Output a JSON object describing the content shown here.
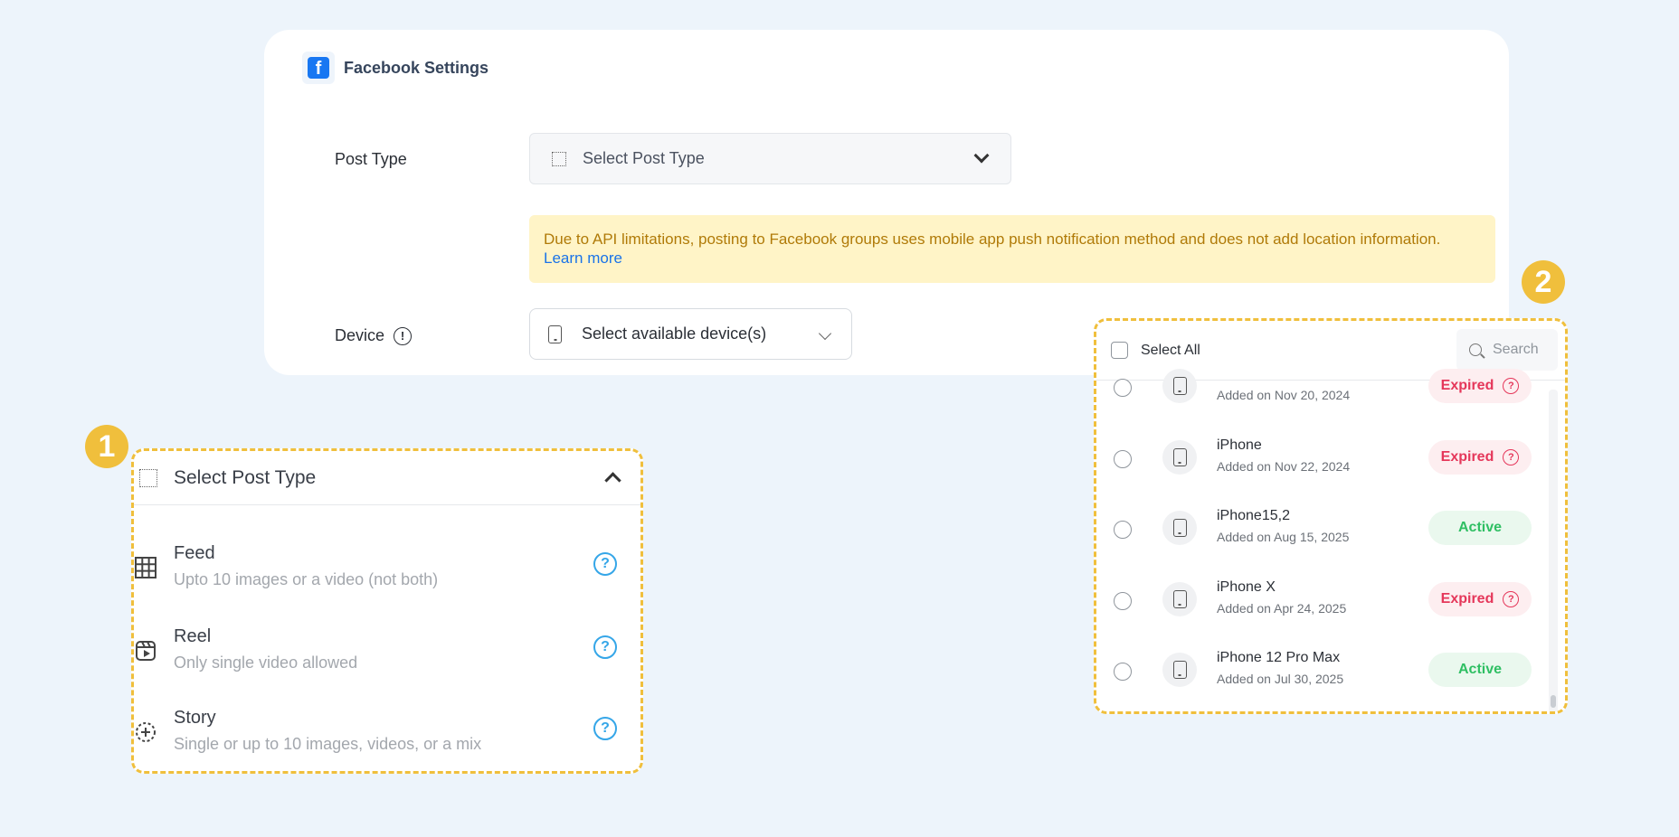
{
  "card": {
    "title": "Facebook Settings",
    "fb_logo_letter": "f",
    "post_type_label": "Post Type",
    "post_type_placeholder": "Select Post Type",
    "notice_text": "Due to API limitations, posting to Facebook groups uses mobile app push notification method and does not add location information.",
    "notice_link": "Learn more",
    "device_label": "Device",
    "device_info_glyph": "!",
    "device_placeholder": "Select available device(s)"
  },
  "callouts": [
    "1",
    "2"
  ],
  "post_type_dropdown": {
    "title": "Select Post Type",
    "options": [
      {
        "name": "Feed",
        "desc": "Upto 10 images or a video (not both)",
        "icon": "grid-icon"
      },
      {
        "name": "Reel",
        "desc": "Only single video allowed",
        "icon": "reel-icon"
      },
      {
        "name": "Story",
        "desc": "Single or up to 10 images, videos, or a mix",
        "icon": "story-icon"
      }
    ],
    "help_glyph": "?"
  },
  "device_dropdown": {
    "select_all": "Select All",
    "search_placeholder": "Search",
    "devices": [
      {
        "name": "",
        "added": "Added on Nov 20, 2024",
        "status": "Expired"
      },
      {
        "name": "iPhone",
        "added": "Added on Nov 22, 2024",
        "status": "Expired"
      },
      {
        "name": "iPhone15,2",
        "added": "Added on Aug 15, 2025",
        "status": "Active"
      },
      {
        "name": "iPhone X",
        "added": "Added on Apr 24, 2025",
        "status": "Expired"
      },
      {
        "name": "iPhone 12 Pro Max",
        "added": "Added on Jul 30, 2025",
        "status": "Active"
      }
    ],
    "status_help_glyph": "?"
  },
  "colors": {
    "accent_callout": "#f0bf3c",
    "facebook_blue": "#1877f2",
    "expired": "#e5375a",
    "active": "#2fbf63",
    "link": "#1a73e8"
  }
}
